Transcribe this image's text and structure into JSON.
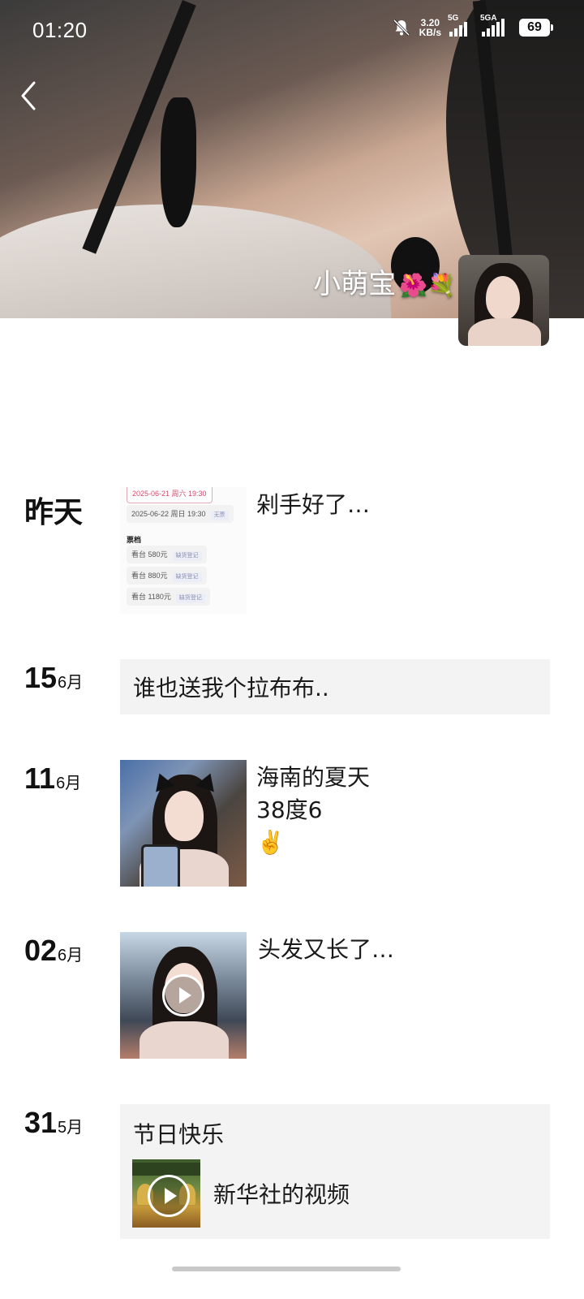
{
  "status_bar": {
    "time": "01:20",
    "speed_value": "3.20",
    "speed_unit": "KB/s",
    "net1": "5G",
    "net2": "5GA",
    "battery": "69"
  },
  "profile": {
    "name": "小萌宝",
    "name_emoji": "🌺💐"
  },
  "posts": [
    {
      "day": "昨天",
      "text": "剁手好了…",
      "ticket": {
        "date1": "2025-06-21 周六 19:30",
        "date2": "2025-06-22 周日 19:30",
        "date2_tag": "无票",
        "section": "票档",
        "price1": "看台 580元",
        "price2": "看台 880元",
        "price3": "看台 1180元",
        "price_tag": "缺货登记"
      }
    },
    {
      "day": "15",
      "month": "6月",
      "text": "谁也送我个拉布布.."
    },
    {
      "day": "11",
      "month": "6月",
      "text": "海南的夏天\n38度6\n✌️"
    },
    {
      "day": "02",
      "month": "6月",
      "text": "头发又长了…"
    },
    {
      "day": "31",
      "month": "5月",
      "text": "节日快乐",
      "video_title": "新华社的视频"
    }
  ]
}
